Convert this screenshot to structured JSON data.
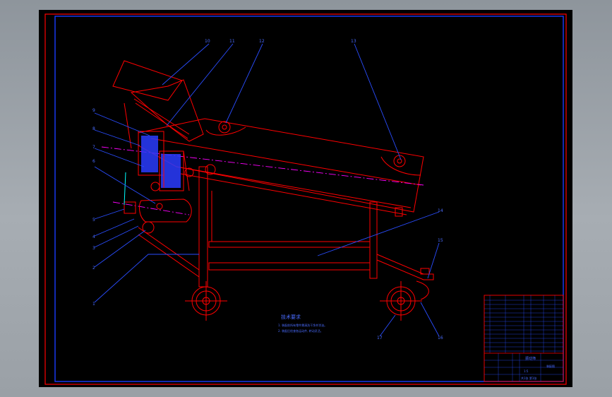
{
  "app": {
    "background": "#000000",
    "workspace_color": "#9ea4aa"
  },
  "drawing": {
    "frame_color": "#ff0000",
    "border_color": "#1a3cff",
    "leader_color": "#2a4dff",
    "centerline_color": "#ff00ff",
    "fill_color": "#2a3cff",
    "label_color": "#4a6cff",
    "part_labels": {
      "p1": "1",
      "p2": "2",
      "p3": "3",
      "p4": "4",
      "p5": "5",
      "p6": "6",
      "p7": "7",
      "p8": "8",
      "p9": "9",
      "p10": "10",
      "p11": "11",
      "p12": "12",
      "p13": "13",
      "p14": "14",
      "p15": "15",
      "p16": "16",
      "p17": "17"
    },
    "notes": {
      "heading": "技术要求",
      "line1": "1. 装配前所有零件需清洗干净并涂油。",
      "line2": "2. 装配后检查各运动件, 转动灵活。"
    },
    "title_block": {
      "title": "振动筛",
      "drawing_no": "装配图",
      "scale": "1:5",
      "sheet": "共1张 第1张"
    }
  }
}
